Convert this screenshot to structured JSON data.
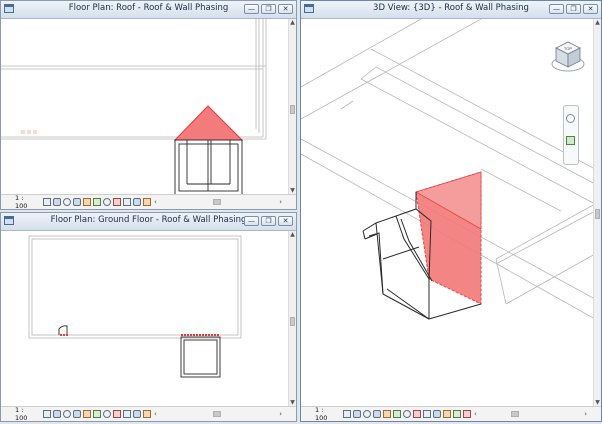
{
  "windows": {
    "roof_plan": {
      "title": "Floor Plan: Roof - Roof & Wall Phasing",
      "scale": "1 : 100"
    },
    "ground_plan": {
      "title": "Floor Plan: Ground Floor - Roof & Wall Phasing",
      "scale": "1 : 100"
    },
    "view_3d": {
      "title": "3D View: {3D} - Roof & Wall Phasing",
      "scale": "1 : 100"
    }
  },
  "window_buttons": {
    "minimize": "—",
    "restore": "❐",
    "close": "✕"
  },
  "scroll_glyphs": {
    "up": "▲",
    "down": "▼",
    "left": "‹",
    "right": "›"
  },
  "viewcube": {
    "face_label": "TOP"
  },
  "colors": {
    "highlight_red": "#f47b7b",
    "highlight_stroke": "#e23c3c",
    "line": "#3a3a3a",
    "light_line": "#b8b8b8"
  },
  "icons": [
    "detail-level-icon",
    "visual-style-icon",
    "sun-path-icon",
    "shadows-icon",
    "crop-view-icon",
    "show-crop-icon",
    "temporary-hide-icon",
    "reveal-hidden-icon",
    "design-options-icon"
  ]
}
